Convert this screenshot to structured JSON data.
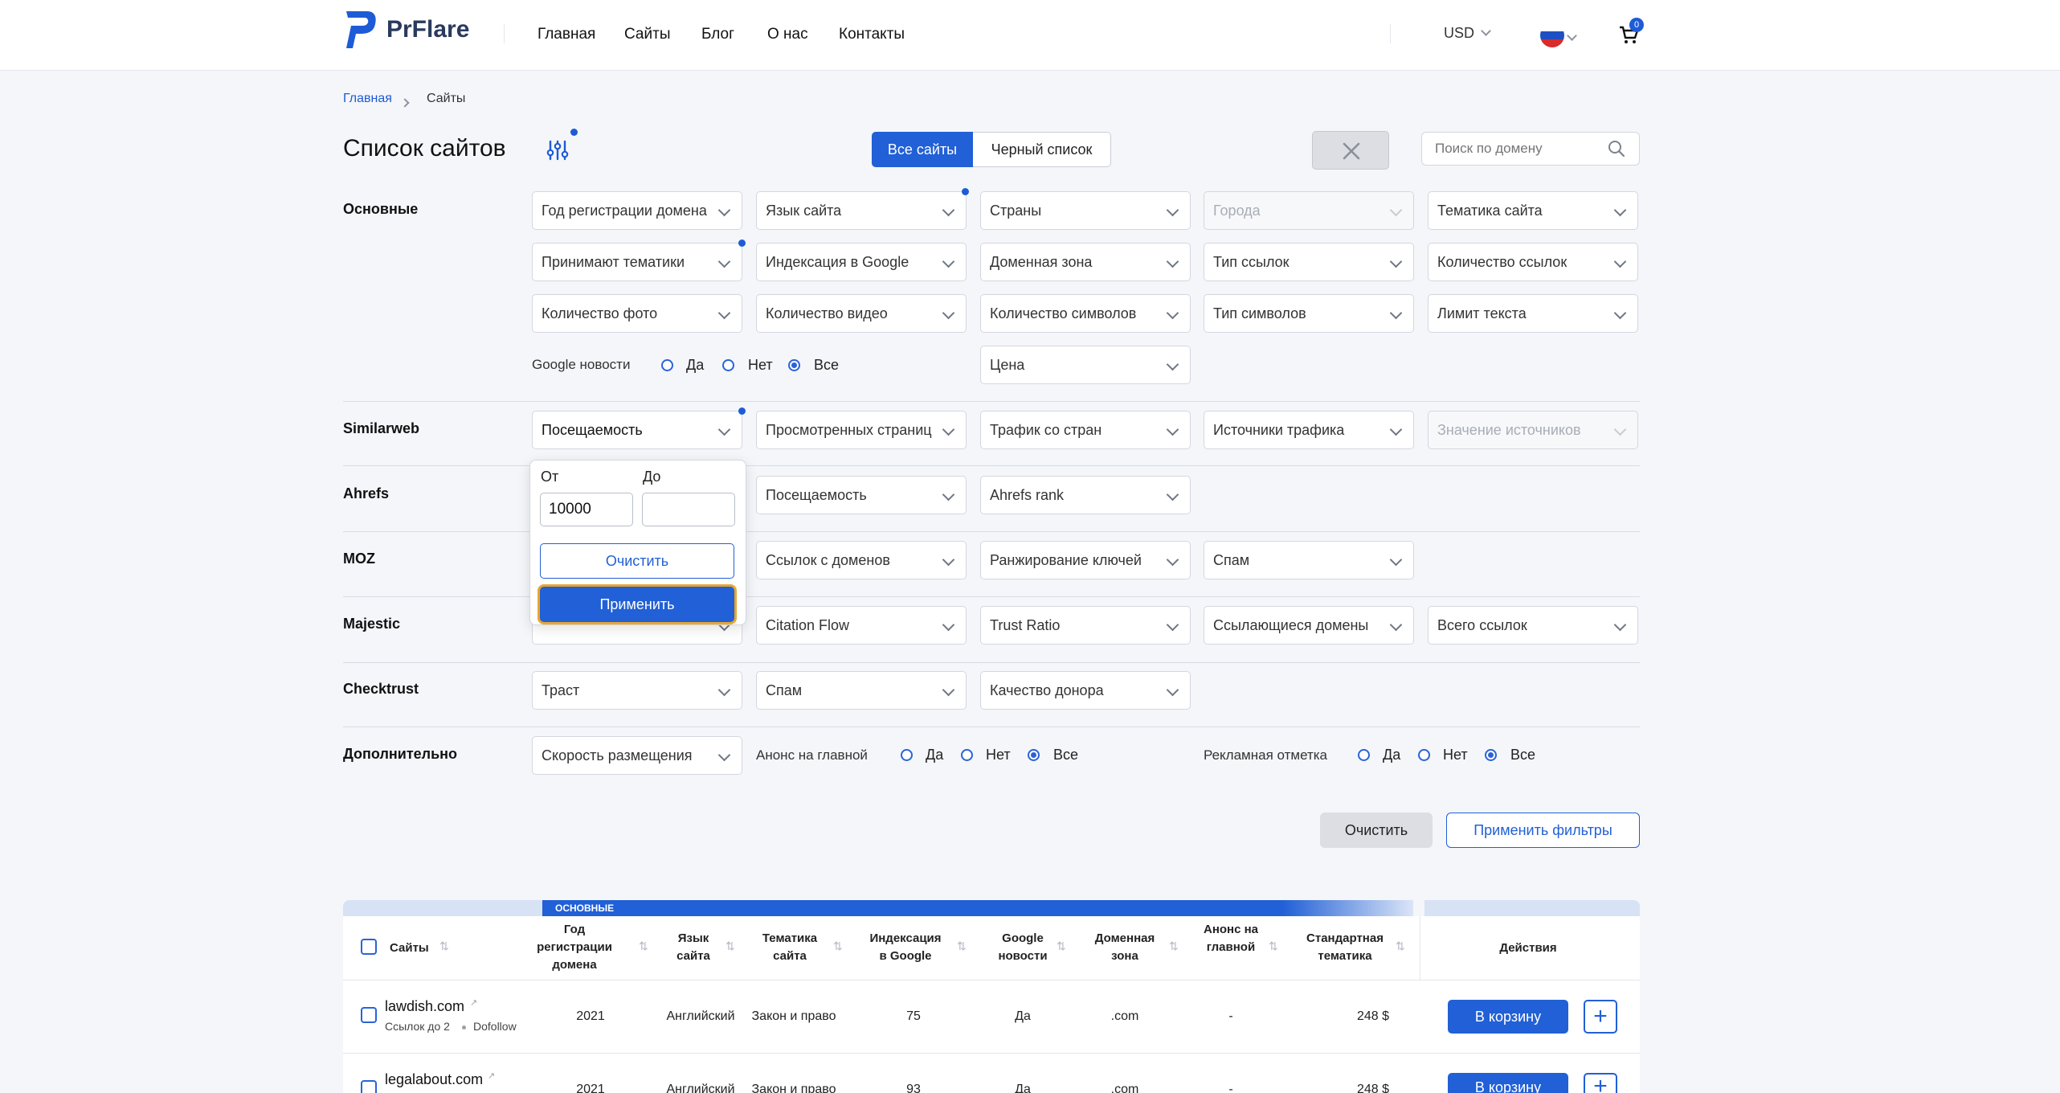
{
  "header": {
    "logo_text": "PrFlare",
    "nav": [
      "Главная",
      "Сайты",
      "Блог",
      "О нас",
      "Контакты"
    ],
    "currency": "USD",
    "cart_count": "0"
  },
  "breadcrumb": {
    "home": "Главная",
    "current": "Сайты"
  },
  "page": {
    "title": "Список сайтов",
    "tab_all": "Все сайты",
    "tab_black": "Черный список",
    "search_placeholder": "Поиск по домену"
  },
  "filters": {
    "main": {
      "label": "Основные",
      "row1": [
        "Год регистрации домена",
        "Язык сайта",
        "Страны",
        "Города",
        "Тематика сайта"
      ],
      "row2": [
        "Принимают тематики",
        "Индексация в Google",
        "Доменная зона",
        "Тип ссылок",
        "Количество ссылок"
      ],
      "row3": [
        "Количество фото",
        "Количество видео",
        "Количество символов",
        "Тип символов",
        "Лимит текста"
      ],
      "google_news": "Google новости",
      "opt_yes": "Да",
      "opt_no": "Нет",
      "opt_all": "Все",
      "price": "Цена"
    },
    "similarweb": {
      "label": "Similarweb",
      "items": [
        "Посещаемость",
        "Просмотренных страниц",
        "Трафик со стран",
        "Источники трафика",
        "Значение источников"
      ]
    },
    "ahrefs": {
      "label": "Ahrefs",
      "items": [
        "Посещаемость",
        "Ahrefs rank"
      ]
    },
    "moz": {
      "label": "MOZ",
      "items": [
        "Ссылок с доменов",
        "Ранжирование ключей",
        "Спам"
      ]
    },
    "majestic": {
      "label": "Majestic",
      "items": [
        "Citation Flow",
        "Trust Ratio",
        "Ссылающиеся домены",
        "Всего ссылок"
      ]
    },
    "checktrust": {
      "label": "Checktrust",
      "items": [
        "Траст",
        "Спам",
        "Качество донора"
      ]
    },
    "extra": {
      "label": "Дополнительно",
      "speed": "Скорость размещения",
      "homepage_announce": "Анонс на главной",
      "ad_mark": "Рекламная отметка",
      "opt_yes": "Да",
      "opt_no": "Нет",
      "opt_all": "Все"
    },
    "clear_button": "Очистить",
    "apply_button": "Применить фильтры"
  },
  "popup": {
    "from_label": "От",
    "to_label": "До",
    "from_value": "10000",
    "to_value": "",
    "clear": "Очистить",
    "apply": "Применить"
  },
  "table": {
    "group_label": "ОСНОВНЫЕ",
    "columns": [
      "Сайты",
      "Год регистрации домена",
      "Язык сайта",
      "Тематика сайта",
      "Индексация в Google",
      "Google новости",
      "Доменная зона",
      "Анонс на главной",
      "Стандартная тематика",
      "Действия"
    ],
    "rows": [
      {
        "site": "lawdish.com",
        "meta1": "Ссылок до 2",
        "meta2": "Dofollow",
        "year": "2021",
        "lang": "Английский",
        "topic": "Закон и право",
        "index": "75",
        "gnews": "Да",
        "zone": ".com",
        "announce": "-",
        "price": "248 $"
      },
      {
        "site": "legalabout.com",
        "meta1": "",
        "meta2": "",
        "year": "2021",
        "lang": "Английский",
        "topic": "Закон и право",
        "index": "93",
        "gnews": "Да",
        "zone": ".com",
        "announce": "-",
        "price": "248 $"
      }
    ],
    "cart_button": "В корзину",
    "plus": "+"
  },
  "colors": {
    "accent": "#2160d6",
    "brand": "#1e5bd6",
    "highlight": "#e8a630"
  }
}
